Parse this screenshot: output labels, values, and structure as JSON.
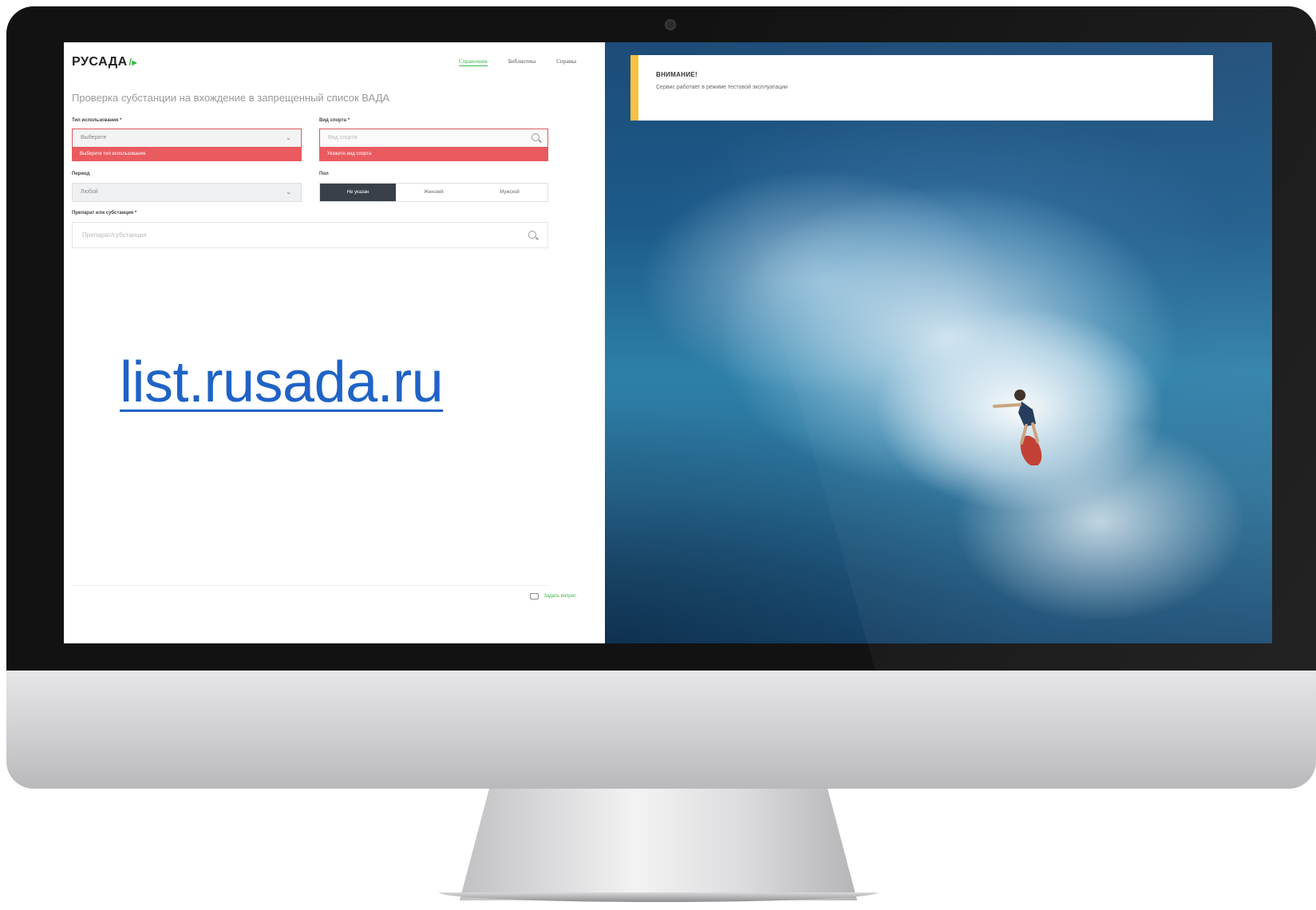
{
  "site": {
    "logo": "РУСАДА",
    "logo_mark": "/▸",
    "nav": [
      {
        "label": "Справочник",
        "active": true
      },
      {
        "label": "Библиотека",
        "active": false
      },
      {
        "label": "Справка",
        "active": false
      }
    ]
  },
  "page": {
    "title": "Проверка субстанции на вхождение в запрещенный список ВАДА"
  },
  "form": {
    "usage_type": {
      "label": "Тип использования *",
      "value": "Выберите",
      "error": "Выберите тип использования"
    },
    "sport": {
      "label": "Вид спорта *",
      "placeholder": "Вид спорта",
      "error": "Укажите вид спорта"
    },
    "period": {
      "label": "Период",
      "value": "Любой"
    },
    "gender": {
      "label": "Пол",
      "options": [
        "Не указан",
        "Женский",
        "Мужской"
      ],
      "selected": "Не указан"
    },
    "substance": {
      "label": "Препарат или субстанция *",
      "placeholder": "Препарат/субстанция"
    }
  },
  "overlay_url": "list.rusada.ru",
  "footer": {
    "ask_label": "Задать вопрос"
  },
  "notice": {
    "title": "ВНИМАНИЕ!",
    "text": "Сервис работает в режиме тестовой эксплуатации"
  },
  "colors": {
    "accent_green": "#3bb54a",
    "error_red": "#ea5b60",
    "notice_yellow": "#f5c242",
    "link_blue": "#1f63c6"
  }
}
